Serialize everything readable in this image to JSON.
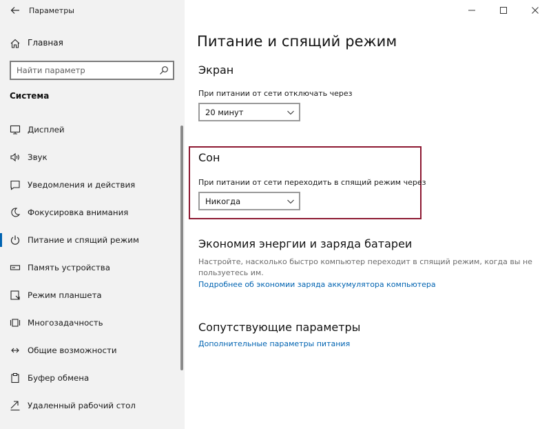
{
  "window": {
    "title": "Параметры",
    "controls": [
      "minimize-icon",
      "maximize-icon",
      "close-icon"
    ]
  },
  "sidebar": {
    "home_label": "Главная",
    "search_placeholder": "Найти параметр",
    "section_title": "Система",
    "items": [
      {
        "label": "Дисплей",
        "icon": "display-icon",
        "active": false
      },
      {
        "label": "Звук",
        "icon": "speaker-icon",
        "active": false
      },
      {
        "label": "Уведомления и действия",
        "icon": "notification-icon",
        "active": false
      },
      {
        "label": "Фокусировка внимания",
        "icon": "focus-moon-icon",
        "active": false
      },
      {
        "label": "Питание и спящий режим",
        "icon": "power-icon",
        "active": true
      },
      {
        "label": "Память устройства",
        "icon": "storage-icon",
        "active": false
      },
      {
        "label": "Режим планшета",
        "icon": "tablet-icon",
        "active": false
      },
      {
        "label": "Многозадачность",
        "icon": "multitasking-icon",
        "active": false
      },
      {
        "label": "Общие возможности",
        "icon": "shared-experiences-icon",
        "active": false
      },
      {
        "label": "Буфер обмена",
        "icon": "clipboard-icon",
        "active": false
      },
      {
        "label": "Удаленный рабочий стол",
        "icon": "remote-desktop-icon",
        "active": false
      }
    ]
  },
  "main": {
    "page_title": "Питание и спящий режим",
    "screen": {
      "heading": "Экран",
      "label": "При питании от сети отключать через",
      "value": "20 минут"
    },
    "sleep": {
      "heading": "Сон",
      "label": "При питании от сети переходить в спящий режим через",
      "value": "Никогда"
    },
    "battery": {
      "heading": "Экономия энергии и заряда батареи",
      "description": "Настройте, насколько быстро компьютер переходит в спящий режим, когда вы не пользуетесь им.",
      "link": "Подробнее об экономии заряда аккумулятора компьютера"
    },
    "related": {
      "heading": "Сопутствующие параметры",
      "link": "Дополнительные параметры питания"
    }
  },
  "colors": {
    "accent": "#0063b1",
    "highlight_border": "#8c1730",
    "sidebar_bg": "#f2f2f2"
  }
}
